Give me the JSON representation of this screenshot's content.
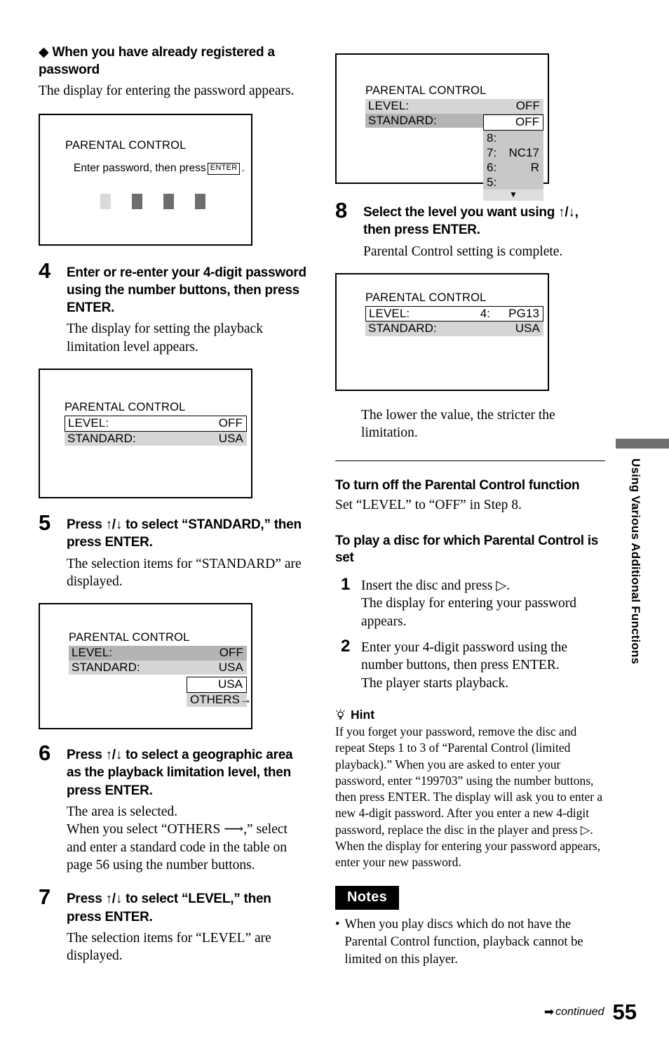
{
  "left_column": {
    "bullet_heading": "◆ When you have already registered a password",
    "bullet_body": "The display for entering the password appears.",
    "screen_password": {
      "title": "PARENTAL CONTROL",
      "prompt_before": "Enter password, then press",
      "prompt_key": "ENTER",
      "prompt_after": ".",
      "boxes": [
        "active",
        "filled",
        "filled",
        "filled"
      ]
    },
    "step4": {
      "number": "4",
      "title": "Enter or re-enter your 4-digit password using the number buttons, then press ENTER.",
      "desc": "The display for setting the playback limitation level appears."
    },
    "screen_level_standard": {
      "title": "PARENTAL CONTROL",
      "rows": [
        {
          "label": "LEVEL:",
          "value": "OFF",
          "style": "selected"
        },
        {
          "label": "STANDARD:",
          "value": "USA",
          "style": "grey-light"
        }
      ]
    },
    "step5": {
      "number": "5",
      "title": "Press ↑/↓ to select “STANDARD,” then press ENTER.",
      "desc": "The selection items for “STANDARD” are displayed."
    },
    "screen_standard_dropdown": {
      "title": "PARENTAL CONTROL",
      "rows": [
        {
          "label": "LEVEL:",
          "value": "OFF",
          "style": "grey-dark"
        },
        {
          "label": "STANDARD:",
          "value": "USA",
          "style": "grey-light"
        }
      ],
      "dropdown": [
        {
          "text": "USA",
          "style": "selected"
        },
        {
          "text": "OTHERS→",
          "style": "grey"
        }
      ]
    },
    "step6": {
      "number": "6",
      "title": "Press ↑/↓ to select a geographic area as the playback limitation level, then press ENTER.",
      "desc_line1": "The area is selected.",
      "desc_line2": "When you select “OTHERS ⟶,” select and enter a standard code in the table on page 56 using the number buttons."
    },
    "step7": {
      "number": "7",
      "title": "Press ↑/↓ to select “LEVEL,” then press ENTER.",
      "desc": "The selection items for “LEVEL” are displayed."
    }
  },
  "right_column": {
    "screen_level_dropdown": {
      "title": "PARENTAL CONTROL",
      "rows": [
        {
          "label": "LEVEL:",
          "value": "OFF",
          "style": "grey-light"
        },
        {
          "label": "STANDARD:",
          "value": "",
          "style": "grey-dark"
        }
      ],
      "dropdown_selected": "OFF",
      "dropdown_levels": [
        {
          "key": "8:",
          "value": ""
        },
        {
          "key": "7:",
          "value": "NC17"
        },
        {
          "key": "6:",
          "value": "R"
        },
        {
          "key": "5:",
          "value": ""
        }
      ],
      "dropdown_more_arrow": "▼"
    },
    "step8": {
      "number": "8",
      "title": "Select the level you want using ↑/↓, then press ENTER.",
      "desc": "Parental Control setting is complete."
    },
    "screen_complete": {
      "title": "PARENTAL CONTROL",
      "rows": [
        {
          "label": "LEVEL:",
          "value_num": "4:",
          "value": "PG13",
          "style": "selected"
        },
        {
          "label": "STANDARD:",
          "value": "USA",
          "style": "grey-light"
        }
      ]
    },
    "after_screen_note": "The lower the value, the stricter the limitation.",
    "turn_off_heading": "To turn off the Parental Control function",
    "turn_off_body": "Set “LEVEL” to “OFF” in Step 8.",
    "play_disc_heading": "To play a disc for which Parental Control is set",
    "play_step1": {
      "number": "1",
      "title": "Insert the disc and press ▷.",
      "desc": "The display for entering your password appears."
    },
    "play_step2": {
      "number": "2",
      "title": "Enter your 4-digit password using the number buttons, then press ENTER.",
      "desc": "The player starts playback."
    },
    "hint": {
      "heading": "Hint",
      "body": "If you forget your password, remove the disc and repeat Steps 1 to 3 of “Parental Control (limited playback).” When you are asked to enter your password, enter “199703” using the number buttons, then press ENTER. The display will ask you to enter a new 4-digit password. After you enter a new 4-digit password, replace the disc in the player and press ▷. When the display for entering your password appears, enter your new password."
    },
    "notes": {
      "badge": "Notes",
      "items": [
        "When you play discs which do not have the Parental Control function, playback cannot be limited on this player."
      ]
    }
  },
  "side_tab": {
    "label": "Using Various Additional Functions"
  },
  "footer": {
    "continued": "continued",
    "page_number": "55"
  },
  "colors": {
    "grey_light": "#d5d5d5",
    "grey_dark": "#b4b4b4",
    "pw_box": "#6e6e6e",
    "pw_box_active": "#d9d9d9"
  }
}
